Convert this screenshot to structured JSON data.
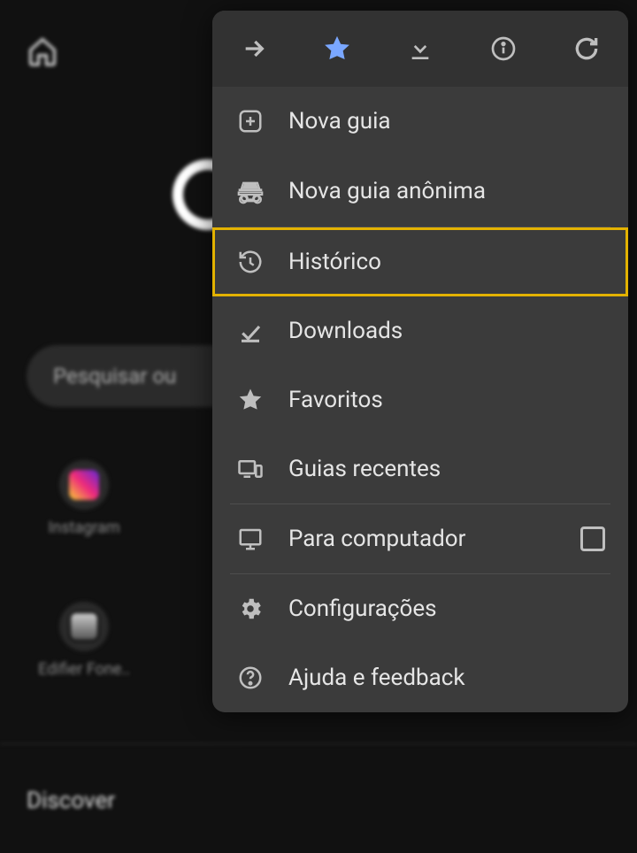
{
  "bg": {
    "search_placeholder": "Pesquisar ou ",
    "shortcut1": "Instagram",
    "shortcut2": "Edifier Fone..",
    "discover": "Discover"
  },
  "menu": {
    "new_tab": "Nova guia",
    "incognito": "Nova guia anônima",
    "history": "Histórico",
    "downloads": "Downloads",
    "bookmarks": "Favoritos",
    "recent_tabs": "Guias recentes",
    "desktop_site": "Para computador",
    "settings": "Configurações",
    "help": "Ajuda e feedback"
  }
}
